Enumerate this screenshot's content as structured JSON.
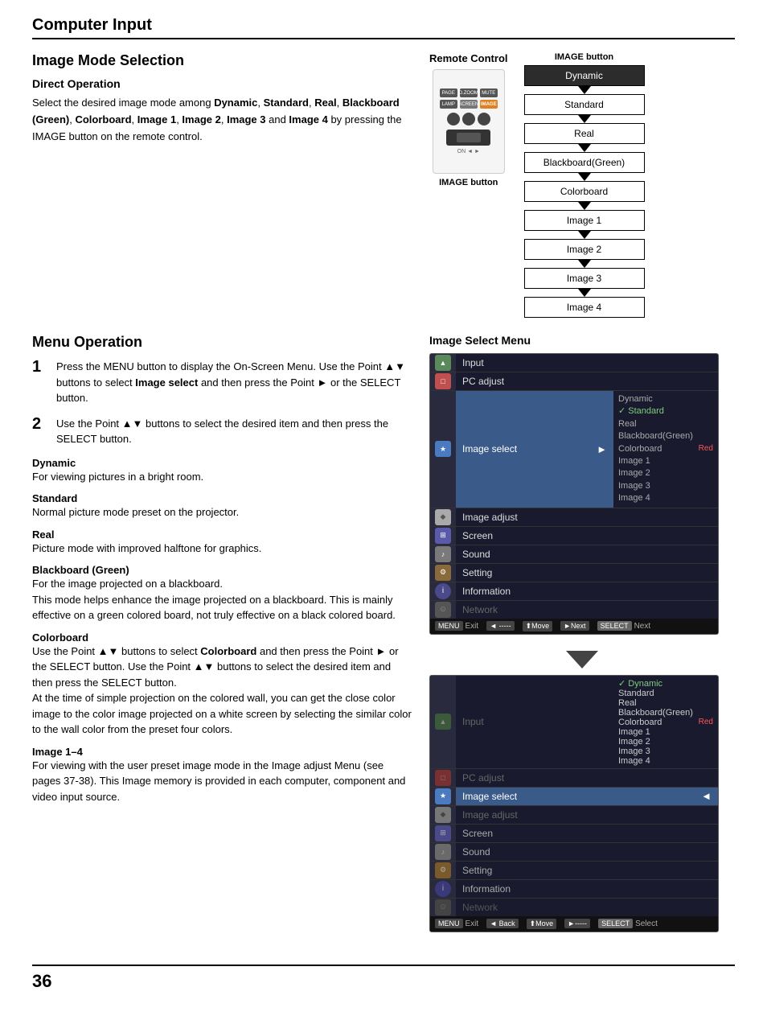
{
  "header": {
    "title": "Computer Input"
  },
  "section1": {
    "title": "Image Mode Selection",
    "subsection1": {
      "title": "Direct Operation",
      "text1": "Select the desired image mode among ",
      "bold_items": [
        "Dynamic",
        "Standard",
        "Real",
        "Blackboard (Green)",
        "Colorboard",
        "Image 1",
        "Image 2",
        "Image 3",
        "Image 4"
      ],
      "text2": " and ",
      "text3": " by pressing the IMAGE button on the remote control.",
      "full_text": "Select the desired image mode among Dynamic, Standard, Real, Blackboard (Green), Colorboard, Image 1, Image 2, Image 3 and Image 4 by pressing the IMAGE button on the remote control."
    },
    "remote_control_label": "Remote Control",
    "image_button_label": "IMAGE button",
    "image_button_label2": "IMAGE button",
    "mode_chain": {
      "top_label": "IMAGE button",
      "modes": [
        "Dynamic",
        "Standard",
        "Real",
        "Blackboard(Green)",
        "Colorboard",
        "Image 1",
        "Image 2",
        "Image 3",
        "Image 4"
      ]
    }
  },
  "section2": {
    "title": "Menu Operation",
    "steps": [
      {
        "num": "1",
        "text": "Press the MENU button to display the On-Screen Menu. Use the Point ▲▼ buttons to select Image select and then press the Point ► or the SELECT button."
      },
      {
        "num": "2",
        "text": "Use the Point ▲▼ buttons to select  the desired item and then press the SELECT button."
      }
    ],
    "descriptions": [
      {
        "title": "Dynamic",
        "text": "For viewing pictures in a bright room."
      },
      {
        "title": "Standard",
        "text": "Normal picture mode preset on the projector."
      },
      {
        "title": "Real",
        "text": "Picture mode with improved halftone for graphics."
      },
      {
        "title": "Blackboard (Green)",
        "text": "For the image projected on a blackboard. This mode helps enhance the image projected on a blackboard. This is mainly effective on a green colored board, not truly effective on a black colored board."
      },
      {
        "title": "Colorboard",
        "text": "Use the Point ▲▼ buttons to select Colorboard and then press the Point ► or the SELECT button. Use the Point ▲▼ buttons to select the desired item and then press the SELECT button. At the time of simple projection on the colored wall, you can get the close color image to the color image projected on a white screen by selecting the similar color to the wall color from the preset four colors."
      },
      {
        "title": "Image 1–4",
        "text": "For viewing with the user preset image mode in the Image adjust Menu (see pages 37-38). This Image memory is provided in each computer, component and video input source."
      }
    ]
  },
  "image_select_menu": {
    "title": "Image Select Menu",
    "menu1": {
      "items": [
        {
          "icon": "▲",
          "label": "Input",
          "active": false
        },
        {
          "icon": "□",
          "label": "PC adjust",
          "active": false
        },
        {
          "icon": "★",
          "label": "Image select",
          "active": true,
          "arrow": "►"
        },
        {
          "icon": "◆",
          "label": "Image adjust",
          "active": false
        },
        {
          "icon": "⊞",
          "label": "Screen",
          "active": false
        },
        {
          "icon": "♪",
          "label": "Sound",
          "active": false
        },
        {
          "icon": "⚙",
          "label": "Setting",
          "active": false
        },
        {
          "icon": "ℹ",
          "label": "Information",
          "active": false
        },
        {
          "icon": "⊙",
          "label": "Network",
          "active": false,
          "dimmed": true
        }
      ],
      "options": [
        {
          "text": "Dynamic",
          "selected": false
        },
        {
          "text": "✓ Standard",
          "selected": true
        },
        {
          "text": "Real",
          "selected": false
        },
        {
          "text": "Blackboard(Green)",
          "selected": false
        },
        {
          "text": "Colorboard",
          "selected": false,
          "red": true
        },
        {
          "text": "Image 1",
          "selected": false
        },
        {
          "text": "Image 2",
          "selected": false
        },
        {
          "text": "Image 3",
          "selected": false
        },
        {
          "text": "Image 4",
          "selected": false
        }
      ],
      "footer": [
        {
          "key": "MENU",
          "text": "Exit"
        },
        {
          "key": "◄ ------",
          "text": ""
        },
        {
          "key": "⬆Move",
          "text": ""
        },
        {
          "key": "►Next",
          "text": ""
        },
        {
          "key": "SELECT",
          "text": "Next"
        }
      ]
    },
    "menu2": {
      "options": [
        {
          "text": "✓ Dynamic",
          "selected": true
        },
        {
          "text": "Standard",
          "selected": false
        },
        {
          "text": "Real",
          "selected": false
        },
        {
          "text": "Blackboard(Green)",
          "selected": false
        },
        {
          "text": "Colorboard",
          "selected": false,
          "red": true
        },
        {
          "text": "Image 1",
          "selected": false
        },
        {
          "text": "Image 2",
          "selected": false
        },
        {
          "text": "Image 3",
          "selected": false
        },
        {
          "text": "Image 4",
          "selected": false
        }
      ],
      "footer": [
        {
          "key": "MENU",
          "text": "Exit"
        },
        {
          "key": "◄ Back",
          "text": ""
        },
        {
          "key": "⬆Move",
          "text": ""
        },
        {
          "key": "►------",
          "text": ""
        },
        {
          "key": "SELECT",
          "text": "Select"
        }
      ]
    }
  },
  "page_number": "36"
}
